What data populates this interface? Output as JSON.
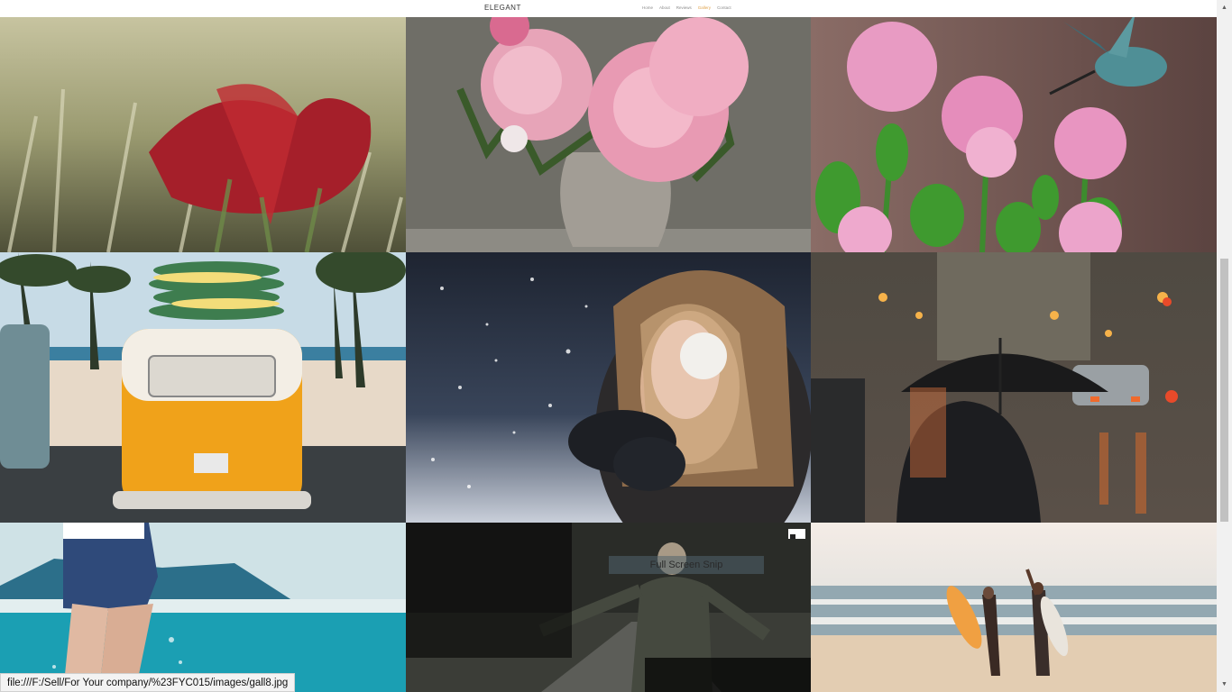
{
  "header": {
    "logo": "ELEGANT",
    "nav": [
      "Home",
      "About",
      "Reviews",
      "Gallery",
      "Contact"
    ],
    "active_nav": "Gallery",
    "accent_color": "#e0a34b"
  },
  "gallery": {
    "tiles": [
      {
        "subject": "red leaf in frosted grass"
      },
      {
        "subject": "pink peonies in a grey vase"
      },
      {
        "subject": "hummingbird over pink flowers"
      },
      {
        "subject": "orange camper van with surfboards"
      },
      {
        "subject": "woman blowing snow"
      },
      {
        "subject": "person with umbrella on rainy street"
      },
      {
        "subject": "legs splashing in sea"
      },
      {
        "subject": "man with open arms on a road"
      },
      {
        "subject": "two surfers on a beach"
      }
    ]
  },
  "overlay": {
    "snip_label": "Full Screen Snip",
    "snip_icon": "full-screen-snip-icon"
  },
  "status_bar": {
    "url": "file:///F:/Sell/For Your company/%23FYC015/images/gall8.jpg"
  },
  "scrollbar": {
    "up_icon": "▲",
    "down_icon": "▼"
  }
}
